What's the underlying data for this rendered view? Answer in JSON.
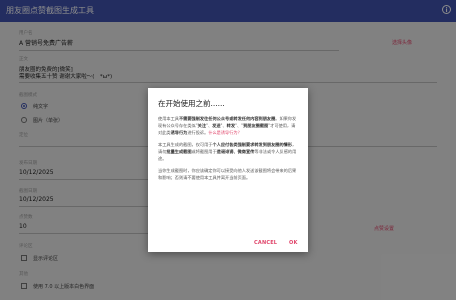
{
  "appbar": {
    "title": "朋友圈点赞截图生成工具",
    "info_icon": "i"
  },
  "form": {
    "user_label": "用户名",
    "user_value": "A 营销号免费广告薪",
    "change_avatar": "选择头像",
    "text_label": "正文",
    "text_line1": "朋友圈的免费的[微笑]",
    "text_line2": "需要收集五十赞  谢谢大家啦～(　*ω*)",
    "image_mode_label": "截图模式",
    "image_mode_options": [
      "纯文字",
      "图片（单张）"
    ],
    "location_label": "定位",
    "publish_date_label": "发布日期",
    "publish_date": "10/12/2025",
    "publish_hour": "23",
    "screenshot_date_label": "截图日期",
    "screenshot_date": "10/12/2025",
    "screenshot_hour": "23",
    "likes_label": "点赞数",
    "likes_value": "10",
    "likes_link": "点赞设置",
    "comments_label": "评论区",
    "comments_option": "显示评论区",
    "other_label": "其他",
    "other_option": "使用 7.0 以上版本白色界面"
  },
  "dialog": {
    "title": "在开始使用之前......",
    "p1_a": "使用本工具",
    "p1_b": "不需要强制发往任何公众号或转发任何内容到朋友圈",
    "p1_c": "。如果你发现有公众号存在类似\"",
    "p1_d": "关注",
    "p1_e": "\"、",
    "p1_f": "发送",
    "p1_g": "\"、",
    "p1_h": "转发",
    "p1_i": "\"、\"",
    "p1_j": "到朋友圈截图",
    "p1_k": "\"才可使用，请对此类",
    "p1_l": "诱导行为",
    "p1_m": "进行投诉。",
    "p1_link": "什么是诱导行为？",
    "p2_a": "本工具生成的截图，仅可用于",
    "p2_b": "个人应付各类强制要求转发到朋友圈的情形",
    "p2_c": "，请勿",
    "p2_d": "批量生成截图",
    "p2_e": "或将截图用于",
    "p2_f": "造谣诽谤、微商宣传",
    "p2_g": "等非法或令人反感的用途。",
    "p3": "当你生成截图时，你应该确定你可以接受向他人发送该截图将会带来的后果和影响；否则请不要使用本工具并离开当前页面。",
    "cancel": "CANCEL",
    "ok": "OK"
  },
  "colors": {
    "appbar": "#4053b0",
    "accent": "#e0456a"
  }
}
